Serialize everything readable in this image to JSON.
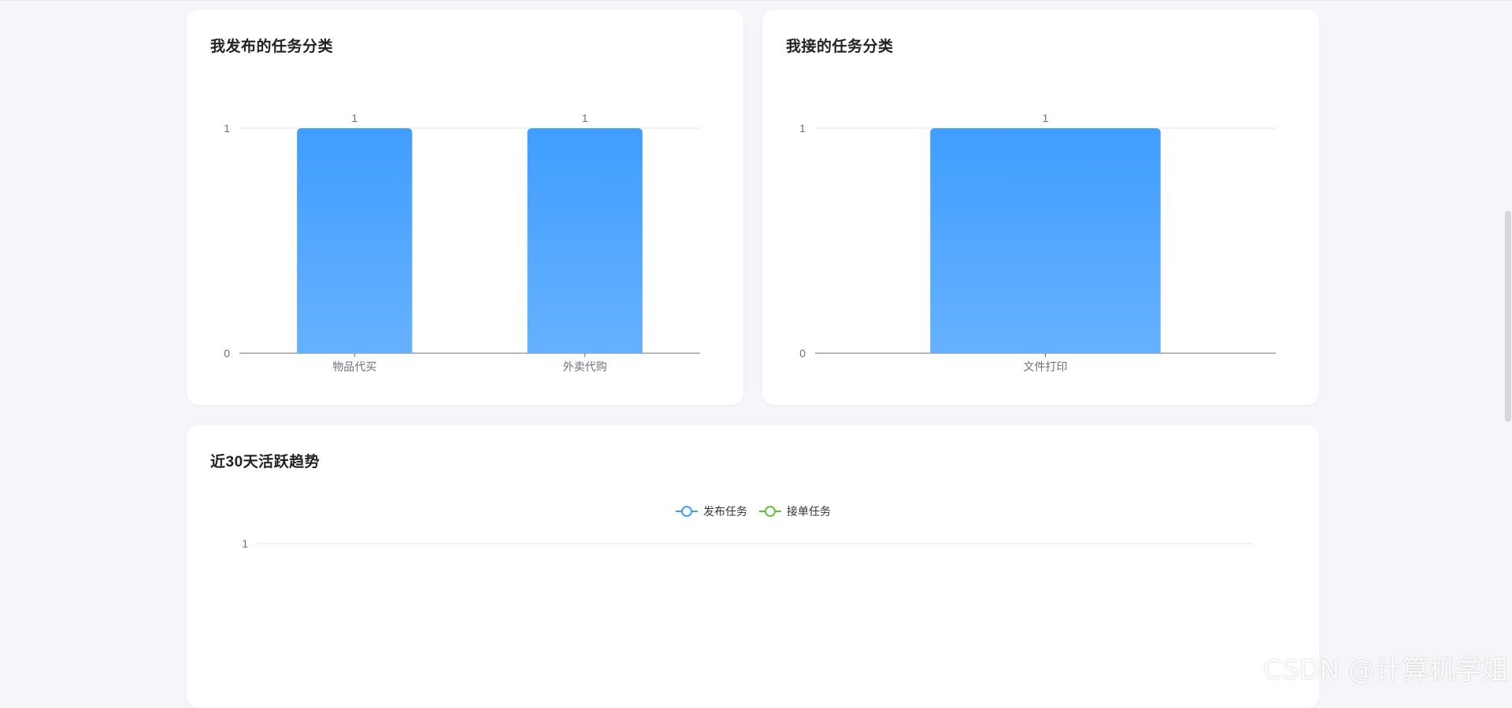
{
  "colors": {
    "bar_top": "#409eff",
    "bar_bottom": "#66b1ff",
    "series_published": "#409eff",
    "series_accepted": "#67c23a",
    "grid": "#e0e6f1",
    "axis": "#6e7079"
  },
  "cards": {
    "published": {
      "title": "我发布的任务分类"
    },
    "accepted": {
      "title": "我接的任务分类"
    },
    "trend": {
      "title": "近30天活跃趋势"
    }
  },
  "chart_data": [
    {
      "type": "bar",
      "title": "我发布的任务分类",
      "categories": [
        "物品代买",
        "外卖代购"
      ],
      "values": [
        1,
        1
      ],
      "ylim": [
        0,
        1
      ],
      "yticks": [
        "0",
        "1"
      ],
      "data_labels": [
        "1",
        "1"
      ],
      "grid": true
    },
    {
      "type": "bar",
      "title": "我接的任务分类",
      "categories": [
        "文件打印"
      ],
      "values": [
        1
      ],
      "ylim": [
        0,
        1
      ],
      "yticks": [
        "0",
        "1"
      ],
      "data_labels": [
        "1"
      ],
      "grid": true
    },
    {
      "type": "line",
      "title": "近30天活跃趋势",
      "series": [
        {
          "name": "发布任务",
          "values": []
        },
        {
          "name": "接单任务",
          "values": []
        }
      ],
      "yticks": [
        "1"
      ],
      "legend": "top-center",
      "grid": true
    }
  ],
  "watermark": "CSDN @计算机学姐"
}
